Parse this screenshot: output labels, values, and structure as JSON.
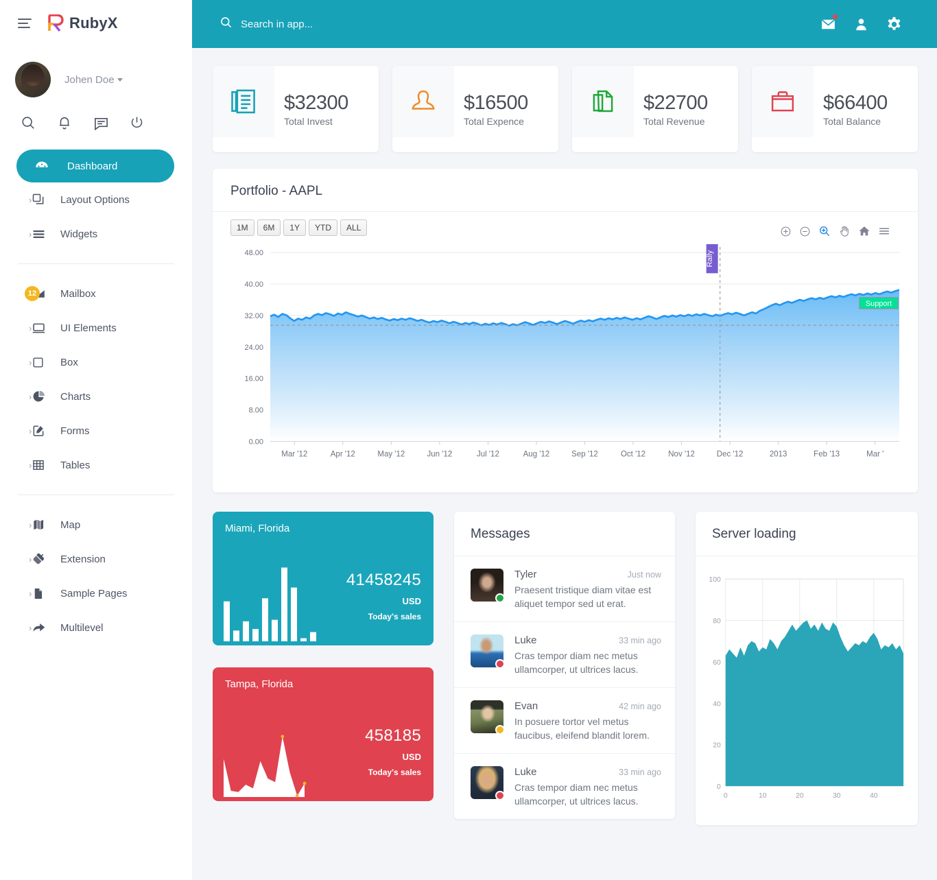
{
  "brand": {
    "name": "RubyX",
    "menu_icon": "hamburger-icon"
  },
  "profile": {
    "name": "Johen Doe"
  },
  "quick_icons": [
    "search-icon",
    "bell-icon",
    "chat-icon",
    "power-icon"
  ],
  "sidebar": {
    "items": [
      {
        "label": "Dashboard",
        "icon": "dashboard-icon",
        "active": true,
        "arrow": false
      },
      {
        "label": "Layout Options",
        "icon": "layers-icon",
        "active": false,
        "arrow": true
      },
      {
        "label": "Widgets",
        "icon": "widgets-icon",
        "active": false,
        "arrow": true
      }
    ],
    "items2": [
      {
        "label": "Mailbox",
        "icon": "envelope-icon",
        "active": false,
        "arrow": false,
        "badge": "12"
      },
      {
        "label": "UI Elements",
        "icon": "monitor-icon",
        "active": false,
        "arrow": true
      },
      {
        "label": "Box",
        "icon": "square-icon",
        "active": false,
        "arrow": true
      },
      {
        "label": "Charts",
        "icon": "pie-chart-icon",
        "active": false,
        "arrow": true
      },
      {
        "label": "Forms",
        "icon": "edit-icon",
        "active": false,
        "arrow": true
      },
      {
        "label": "Tables",
        "icon": "table-icon",
        "active": false,
        "arrow": true
      }
    ],
    "items3": [
      {
        "label": "Map",
        "icon": "map-icon",
        "active": false,
        "arrow": true
      },
      {
        "label": "Extension",
        "icon": "plug-icon",
        "active": false,
        "arrow": true
      },
      {
        "label": "Sample Pages",
        "icon": "file-icon",
        "active": false,
        "arrow": true
      },
      {
        "label": "Multilevel",
        "icon": "share-icon",
        "active": false,
        "arrow": true
      }
    ]
  },
  "topbar": {
    "search_placeholder": "Search in app...",
    "search_value": "",
    "icons": [
      "mail-icon",
      "user-icon",
      "gear-icon"
    ],
    "mail_has_badge": true,
    "accent": "#17a2b8"
  },
  "stats": [
    {
      "value": "$32300",
      "label": "Total Invest",
      "icon": "document-list-icon",
      "color": "#17a2b8"
    },
    {
      "value": "$16500",
      "label": "Total Expence",
      "icon": "person-icon",
      "color": "#f08a24"
    },
    {
      "value": "$22700",
      "label": "Total Revenue",
      "icon": "copy-file-icon",
      "color": "#1fa93b"
    },
    {
      "value": "$66400",
      "label": "Total Balance",
      "icon": "briefcase-icon",
      "color": "#e0424f"
    }
  ],
  "portfolio": {
    "title": "Portfolio - AAPL",
    "ranges": [
      "1M",
      "6M",
      "1Y",
      "YTD",
      "ALL"
    ],
    "tools": [
      "zoom-in-icon",
      "zoom-out-icon",
      "selection-zoom-icon",
      "pan-icon",
      "home-icon",
      "menu-icon"
    ],
    "active_tool": "selection-zoom-icon"
  },
  "sales_cards": [
    {
      "city": "Miami, Florida",
      "amount": "41458245",
      "currency": "USD",
      "caption": "Today's sales",
      "color": "#1ba5ba",
      "graph_type": "bar",
      "bars": [
        52,
        14,
        26,
        16,
        56,
        28,
        96,
        70,
        4,
        12
      ]
    },
    {
      "city": "Tampa, Florida",
      "amount": "458185",
      "currency": "USD",
      "caption": "Today's sales",
      "color": "#e0424f",
      "graph_type": "area",
      "points": [
        62,
        10,
        8,
        20,
        14,
        58,
        30,
        24,
        98,
        40,
        2,
        22
      ]
    }
  ],
  "messages": {
    "title": "Messages",
    "items": [
      {
        "name": "Tyler",
        "time": "Just now",
        "text": "Praesent tristique diam vitae est aliquet tempor sed ut erat.",
        "status": "online",
        "status_color": "#22a745",
        "avatar": "woman-dark-hair"
      },
      {
        "name": "Luke",
        "time": "33 min ago",
        "text": "Cras tempor diam nec metus ullamcorper, ut ultrices lacus.",
        "status": "busy",
        "status_color": "#e0424f",
        "avatar": "man-sunglasses"
      },
      {
        "name": "Evan",
        "time": "42 min ago",
        "text": "In posuere tortor vel metus faucibus, eleifend blandit lorem.",
        "status": "away",
        "status_color": "#f5b721",
        "avatar": "woman-hat"
      },
      {
        "name": "Luke",
        "time": "33 min ago",
        "text": "Cras tempor diam nec metus ullamcorper, ut ultrices lacus.",
        "status": "busy",
        "status_color": "#e0424f",
        "avatar": "woman-curly-blonde"
      }
    ]
  },
  "server": {
    "title": "Server loading"
  },
  "chart_data": [
    {
      "type": "area",
      "title": "Portfolio - AAPL",
      "xlabel": "",
      "ylabel": "",
      "ylim": [
        0,
        48
      ],
      "yticks": [
        0.0,
        8.0,
        16.0,
        24.0,
        32.0,
        40.0,
        48.0
      ],
      "ytick_labels": [
        "0.00",
        "8.00",
        "16.00",
        "24.00",
        "32.00",
        "40.00",
        "48.00"
      ],
      "xtick_labels": [
        "Mar '12",
        "Apr '12",
        "May '12",
        "Jun '12",
        "Jul '12",
        "Aug '12",
        "Sep '12",
        "Oct '12",
        "Nov '12",
        "Dec '12",
        "2013",
        "Feb '13",
        "Mar '"
      ],
      "grid": true,
      "series_color": "#2196f3",
      "annotations": [
        {
          "label": "Rally",
          "type": "x-axis-vertical",
          "color": "#775dd0",
          "x_position": 0.715
        },
        {
          "label": "Support",
          "type": "y-axis-horizontal",
          "color": "#00e396",
          "y_value": 29.5
        }
      ],
      "values": [
        31.8,
        32.2,
        31.6,
        32.4,
        32.1,
        31.3,
        30.6,
        31.2,
        30.9,
        31.5,
        31.2,
        32.0,
        32.4,
        32.1,
        32.6,
        32.3,
        31.9,
        32.5,
        32.2,
        32.8,
        32.4,
        32.1,
        31.7,
        32.0,
        31.6,
        31.2,
        31.5,
        31.1,
        31.4,
        31.0,
        30.7,
        31.1,
        30.8,
        31.2,
        30.9,
        31.3,
        31.0,
        30.6,
        30.9,
        30.5,
        30.2,
        30.6,
        30.3,
        30.7,
        30.4,
        30.0,
        30.4,
        30.1,
        29.7,
        30.1,
        29.8,
        30.2,
        29.9,
        29.5,
        29.9,
        29.6,
        30.0,
        29.7,
        30.1,
        29.8,
        29.4,
        29.8,
        29.5,
        29.9,
        30.3,
        30.0,
        29.6,
        30.0,
        30.4,
        30.1,
        30.5,
        30.2,
        29.8,
        30.2,
        30.6,
        30.3,
        29.9,
        30.3,
        30.7,
        30.4,
        30.8,
        30.5,
        30.9,
        31.2,
        30.9,
        31.3,
        31.0,
        31.4,
        31.1,
        31.5,
        31.2,
        30.9,
        31.3,
        31.0,
        31.4,
        31.8,
        31.5,
        31.1,
        31.5,
        31.9,
        31.6,
        32.0,
        31.7,
        32.1,
        31.8,
        32.2,
        31.9,
        32.3,
        32.0,
        32.4,
        32.1,
        31.8,
        32.2,
        31.9,
        32.3,
        32.6,
        32.3,
        32.7,
        32.4,
        32.0,
        32.4,
        32.8,
        32.5,
        33.2,
        33.6,
        34.1,
        34.6,
        35.0,
        34.6,
        35.1,
        35.5,
        35.2,
        35.6,
        36.0,
        35.7,
        36.1,
        36.4,
        36.1,
        36.5,
        36.2,
        36.6,
        36.9,
        36.6,
        37.0,
        36.7,
        37.1,
        37.4,
        37.1,
        37.5,
        37.2,
        37.6,
        37.3,
        37.7,
        37.4,
        37.8,
        38.1,
        37.8,
        38.2,
        38.5
      ]
    },
    {
      "type": "area",
      "title": "Server loading",
      "xlabel": "",
      "ylabel": "",
      "ylim": [
        0,
        100
      ],
      "yticks": [
        0,
        20,
        40,
        60,
        80,
        100
      ],
      "ytick_labels": [
        "0",
        "20",
        "40",
        "60",
        "80",
        "100"
      ],
      "xlim": [
        0,
        48
      ],
      "xticks": [
        0,
        10,
        20,
        30,
        40
      ],
      "xtick_labels": [
        "0",
        "10",
        "20",
        "30",
        "40"
      ],
      "grid": true,
      "series_color": "#2ba6b8",
      "values": [
        63,
        66,
        64,
        62,
        67,
        63,
        68,
        70,
        69,
        65,
        67,
        66,
        71,
        69,
        66,
        70,
        72,
        75,
        78,
        75,
        77,
        79,
        80,
        76,
        78,
        75,
        79,
        76,
        75,
        79,
        77,
        72,
        68,
        65,
        67,
        69,
        68,
        70,
        69,
        72,
        74,
        71,
        66,
        68,
        67,
        69,
        66,
        68,
        64
      ]
    }
  ]
}
